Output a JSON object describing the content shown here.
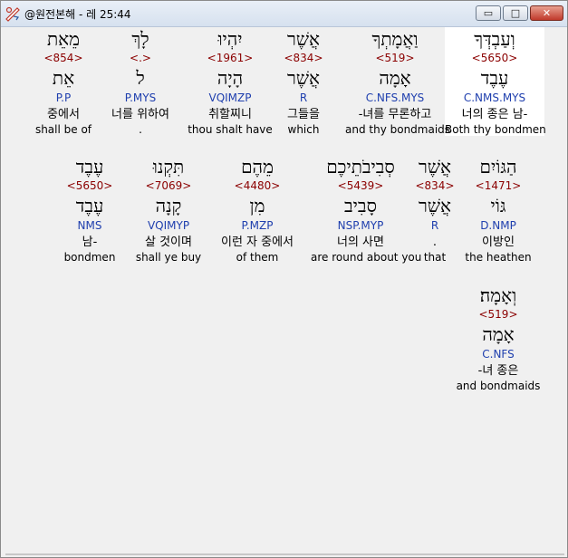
{
  "window": {
    "title": "@원전본해 - 레 25:44",
    "controls": {
      "minimize": "▭",
      "maximize": "□",
      "close": "✕"
    }
  },
  "rows": [
    [
      {
        "heb": "וְעַבְדְּךָ",
        "strong": "<5650>",
        "lemma": "עֶבֶד",
        "morph": "C.NMS.MYS",
        "kor": "너의 종은 남-",
        "eng": "Both thy bondmen",
        "selected": true
      },
      {
        "heb": "וַאֲמָתְךָ",
        "strong": "<519>",
        "lemma": "אָמָה",
        "morph": "C.NFS.MYS",
        "kor": "-녀를 무론하고",
        "eng": "and thy bondmaids"
      },
      {
        "heb": "אֲשֶׁר",
        "strong": "<834>",
        "lemma": "אֲשֶׁר",
        "morph": "R",
        "kor": "그들을",
        "eng": "which"
      },
      {
        "heb": "יִהְיוּ",
        "strong": "<1961>",
        "lemma": "הָיָה",
        "morph": "VQIMZP",
        "kor": "취할찌니",
        "eng": "thou shalt have"
      },
      {
        "heb": "לָךְ",
        "strong": "<.>",
        "lemma": "ל",
        "morph": "P.MYS",
        "kor": "너를 위하여",
        "eng": "."
      },
      {
        "heb": "מֵאֵת",
        "strong": "<854>",
        "lemma": "אֵת",
        "morph": "P.P",
        "kor": "중에서",
        "eng": "shall be of"
      }
    ],
    [
      {
        "heb": "הַגּוֹיִם",
        "strong": "<1471>",
        "lemma": "גּוֹי",
        "morph": "D.NMP",
        "kor": "이방인",
        "eng": "the heathen"
      },
      {
        "heb": "אֲשֶׁר",
        "strong": "<834>",
        "lemma": "אֲשֶׁר",
        "morph": "R",
        "kor": ".",
        "eng": "that"
      },
      {
        "heb": "סְבִיבֹתֵיכֶם",
        "strong": "<5439>",
        "lemma": "סָבִיב",
        "morph": "NSP.MYP",
        "kor": "너의 사면",
        "eng": "are round about you"
      },
      {
        "heb": "מֵהֶם",
        "strong": "<4480>",
        "lemma": "מִן",
        "morph": "P.MZP",
        "kor": "이런 자 중에서",
        "eng": "of them"
      },
      {
        "heb": "תִּקְנוּ",
        "strong": "<7069>",
        "lemma": "קָנָה",
        "morph": "VQIMYP",
        "kor": "살 것이며",
        "eng": "shall ye buy"
      },
      {
        "heb": "עֶבֶד",
        "strong": "<5650>",
        "lemma": "עֶבֶד",
        "morph": "NMS",
        "kor": "남-",
        "eng": "bondmen"
      }
    ],
    [
      {
        "heb": "וְאָמָה׃",
        "strong": "<519>",
        "lemma": "אָמָה",
        "morph": "C.NFS",
        "kor": "-녀 종은",
        "eng": "and bondmaids"
      }
    ]
  ]
}
